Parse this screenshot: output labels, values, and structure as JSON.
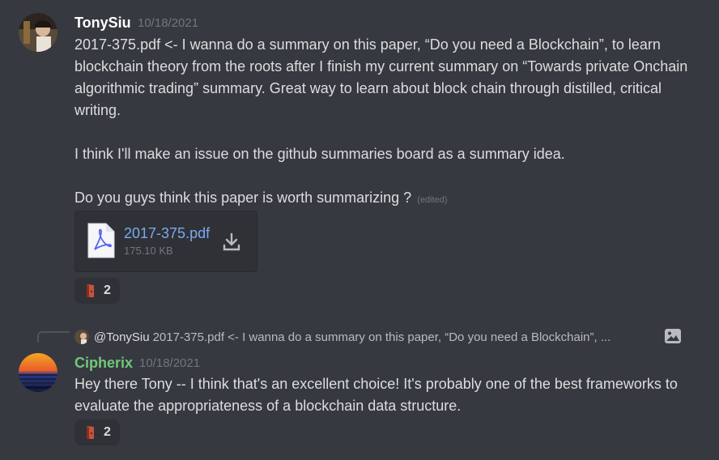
{
  "message1": {
    "username": "TonySiu",
    "timestamp": "10/18/2021",
    "paragraphs": [
      "2017-375.pdf <- I wanna do a summary on this paper, “Do you need a Blockchain”, to learn blockchain theory from the roots after I finish my current summary on “Towards private Onchain algorithmic trading” summary. Great way to learn about block chain through distilled, critical writing.",
      "I think I'll make an issue on the github summaries board as a summary idea."
    ],
    "last_line": "Do you guys think this paper is worth summarizing ?",
    "edited": "(edited)",
    "attachment": {
      "name": "2017-375.pdf",
      "size": "175.10 KB",
      "icon": "pdf-file-icon"
    },
    "reaction": {
      "emoji": "door-emoji",
      "count": "2"
    }
  },
  "message2": {
    "reply": {
      "user": "@TonySiu",
      "text": "2017-375.pdf <- I wanna do a summary on this paper, “Do you need a Blockchain”, ..."
    },
    "username": "Cipherix",
    "timestamp": "10/18/2021",
    "text": "Hey there Tony -- I think that's an excellent choice! It's probably one of the best frameworks to evaluate the appropriateness of a blockchain data structure.",
    "reaction": {
      "emoji": "door-emoji",
      "count": "2"
    }
  },
  "colors": {
    "tonysiu_name": "#ffffff",
    "cipherix_name": "#72c87a",
    "link": "#7aa9f0"
  }
}
